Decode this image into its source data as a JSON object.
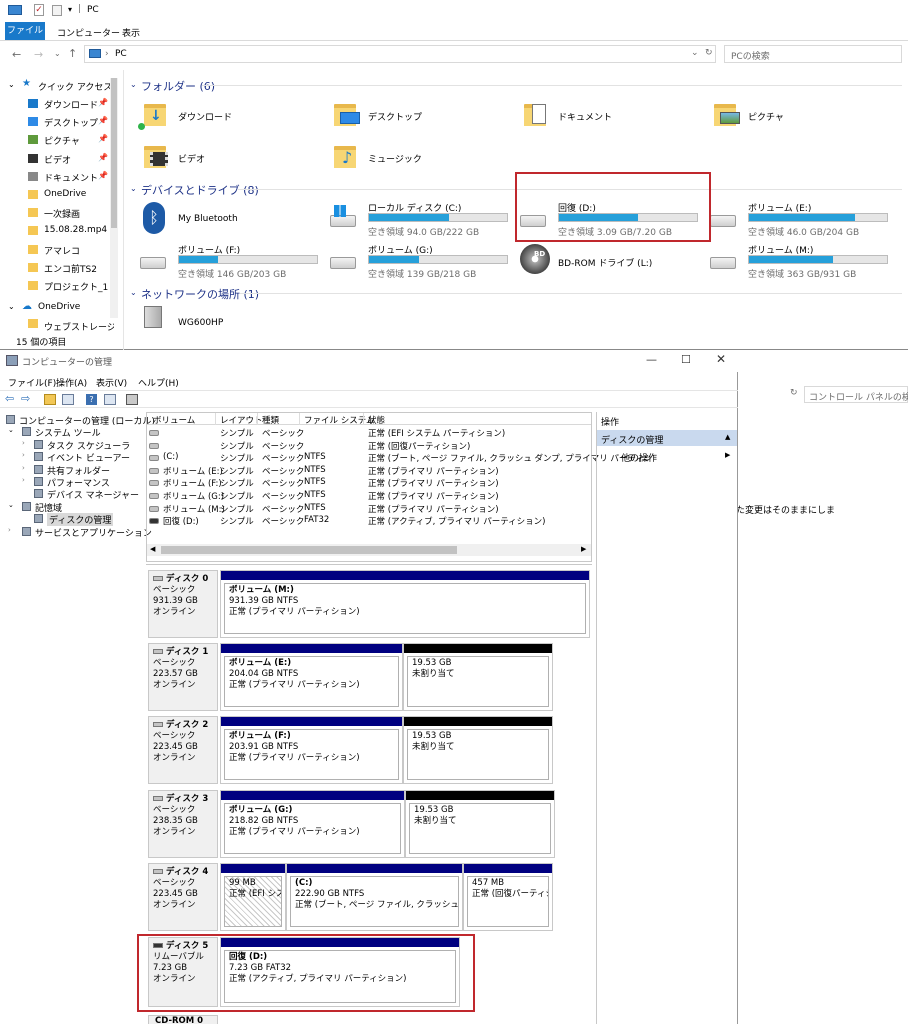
{
  "explorer": {
    "title": "PC",
    "ribbon_tabs": [
      "ファイル",
      "コンピューター",
      "表示"
    ],
    "address": "PC",
    "search_placeholder": "PCの検索",
    "nav": {
      "quick_access": "クイック アクセス",
      "items": [
        "ダウンロード",
        "デスクトップ",
        "ピクチャ",
        "ビデオ",
        "ドキュメント",
        "OneDrive",
        "一次録画",
        "15.08.28.mp4",
        "アマレコ",
        "エンコ前TS2",
        "プロジェクト_1"
      ],
      "onedrive": "OneDrive",
      "onedrive_child": "ウェブストレージ設定"
    },
    "status": "15 個の項目",
    "folders_header": "フォルダー (6)",
    "folders": [
      "ダウンロード",
      "デスクトップ",
      "ドキュメント",
      "ピクチャ",
      "ビデオ",
      "ミュージック"
    ],
    "devices_header": "デバイスとドライブ (8)",
    "bluetooth": "My Bluetooth",
    "drives": [
      {
        "name": "ローカル ディスク (C:)",
        "free": "空き領域 94.0 GB/222 GB",
        "used": 0.58
      },
      {
        "name": "回復 (D:)",
        "free": "空き領域 3.09 GB/7.20 GB",
        "used": 0.57
      },
      {
        "name": "ボリューム (E:)",
        "free": "空き領域 46.0 GB/204 GB",
        "used": 0.77
      },
      {
        "name": "ボリューム (F:)",
        "free": "空き領域 146 GB/203 GB",
        "used": 0.28
      },
      {
        "name": "ボリューム (G:)",
        "free": "空き領域 139 GB/218 GB",
        "used": 0.36
      },
      {
        "name": "ボリューム (M:)",
        "free": "空き領域 363 GB/931 GB",
        "used": 0.61
      }
    ],
    "bdrom": "BD-ROM ドライブ (L:)",
    "network_header": "ネットワークの場所 (1)",
    "network_item": "WG600HP"
  },
  "mgmt": {
    "title": "コンピューターの管理",
    "menu": [
      "ファイル(F)",
      "操作(A)",
      "表示(V)",
      "ヘルプ(H)"
    ],
    "tree": [
      "コンピューターの管理 (ローカル)",
      "システム ツール",
      "タスク スケジューラ",
      "イベント ビューアー",
      "共有フォルダー",
      "パフォーマンス",
      "デバイス マネージャー",
      "記憶域",
      "ディスクの管理",
      "サービスとアプリケーション"
    ],
    "columns": [
      "ボリューム",
      "レイアウト",
      "種類",
      "ファイル システム",
      "状態"
    ],
    "rows": [
      [
        "",
        "シンプル",
        "ベーシック",
        "",
        "正常 (EFI システム パーティション)"
      ],
      [
        "",
        "シンプル",
        "ベーシック",
        "",
        "正常 (回復パーティション)"
      ],
      [
        "(C:)",
        "シンプル",
        "ベーシック",
        "NTFS",
        "正常 (ブート, ページ ファイル, クラッシュ ダンプ, プライマリ パーティシ"
      ],
      [
        "ボリューム (E:)",
        "シンプル",
        "ベーシック",
        "NTFS",
        "正常 (プライマリ パーティション)"
      ],
      [
        "ボリューム (F:)",
        "シンプル",
        "ベーシック",
        "NTFS",
        "正常 (プライマリ パーティション)"
      ],
      [
        "ボリューム (G:)",
        "シンプル",
        "ベーシック",
        "NTFS",
        "正常 (プライマリ パーティション)"
      ],
      [
        "ボリューム (M:)",
        "シンプル",
        "ベーシック",
        "NTFS",
        "正常 (プライマリ パーティション)"
      ],
      [
        "回復 (D:)",
        "シンプル",
        "ベーシック",
        "FAT32",
        "正常 (アクティブ, プライマリ パーティション)"
      ]
    ],
    "actions_header": "操作",
    "actions_section": "ディスクの管理",
    "actions_other": "他の操作",
    "disks": [
      {
        "name": "ディスク 0",
        "type": "ベーシック",
        "size": "931.39 GB",
        "state": "オンライン"
      },
      {
        "name": "ディスク 1",
        "type": "ベーシック",
        "size": "223.57 GB",
        "state": "オンライン"
      },
      {
        "name": "ディスク 2",
        "type": "ベーシック",
        "size": "223.45 GB",
        "state": "オンライン"
      },
      {
        "name": "ディスク 3",
        "type": "ベーシック",
        "size": "238.35 GB",
        "state": "オンライン"
      },
      {
        "name": "ディスク 4",
        "type": "ベーシック",
        "size": "223.45 GB",
        "state": "オンライン"
      },
      {
        "name": "ディスク 5",
        "type": "リムーバブル",
        "size": "7.23 GB",
        "state": "オンライン"
      }
    ],
    "parts": {
      "d0": [
        "ボリューム (M:)",
        "931.39 GB NTFS",
        "正常 (プライマリ パーティション)"
      ],
      "d1a": [
        "ボリューム (E:)",
        "204.04 GB NTFS",
        "正常 (プライマリ パーティション)"
      ],
      "d1b": [
        "19.53 GB",
        "未割り当て"
      ],
      "d2a": [
        "ボリューム (F:)",
        "203.91 GB NTFS",
        "正常 (プライマリ パーティション)"
      ],
      "d2b": [
        "19.53 GB",
        "未割り当て"
      ],
      "d3a": [
        "ボリューム (G:)",
        "218.82 GB NTFS",
        "正常 (プライマリ パーティション)"
      ],
      "d3b": [
        "19.53 GB",
        "未割り当て"
      ],
      "d4a": [
        "99 MB",
        "正常 (EFI シス"
      ],
      "d4b": [
        "(C:)",
        "222.90 GB NTFS",
        "正常 (ブート, ページ ファイル, クラッシュ ダンプ, プ"
      ],
      "d4c": [
        "457 MB",
        "正常 (回復パーティシ"
      ],
      "d5": [
        "回復 (D:)",
        "7.23 GB FAT32",
        "正常 (アクティブ, プライマリ パーティション)"
      ]
    },
    "cdrom": "CD-ROM 0"
  },
  "behind": {
    "search_placeholder": "コントロール パネルの検索",
    "text": "た変更はそのままにしま"
  },
  "colors": {
    "accent": "#1979ca",
    "highlight": "#c0282d",
    "partition": "#000080"
  }
}
